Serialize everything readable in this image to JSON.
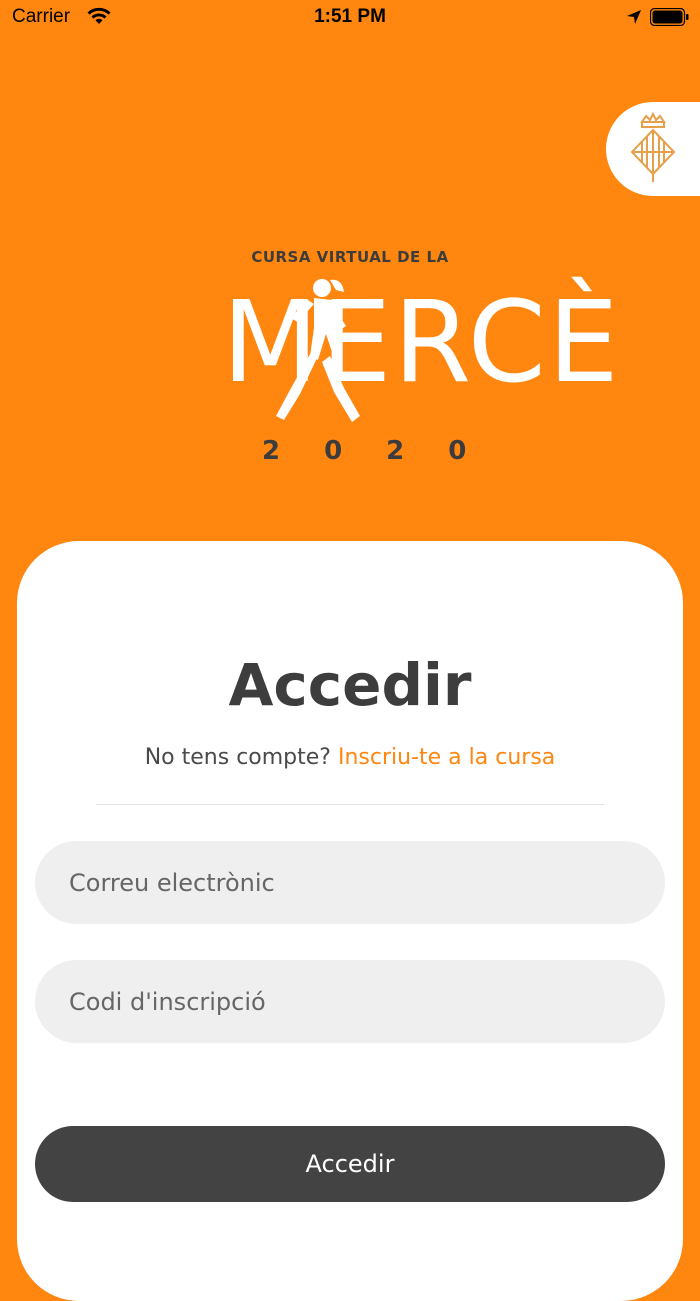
{
  "status_bar": {
    "carrier": "Carrier",
    "time": "1:51 PM",
    "icons": [
      "wifi-icon",
      "location-arrow-icon",
      "battery-icon"
    ]
  },
  "header": {
    "crest_icon": "barcelona-crest-icon"
  },
  "logo": {
    "line1": "CURSA VIRTUAL DE LA",
    "word": "MERCÈ",
    "year": "2020"
  },
  "login": {
    "title": "Accedir",
    "no_account_text": "No tens compte?",
    "signup_link": "Inscriu-te a la cursa",
    "email_placeholder": "Correu electrònic",
    "email_value": "",
    "code_placeholder": "Codi d'inscripció",
    "code_value": "",
    "submit_label": "Accedir"
  },
  "colors": {
    "brand_orange": "#FF860F",
    "dark": "#434343",
    "field_bg": "#efefef"
  }
}
